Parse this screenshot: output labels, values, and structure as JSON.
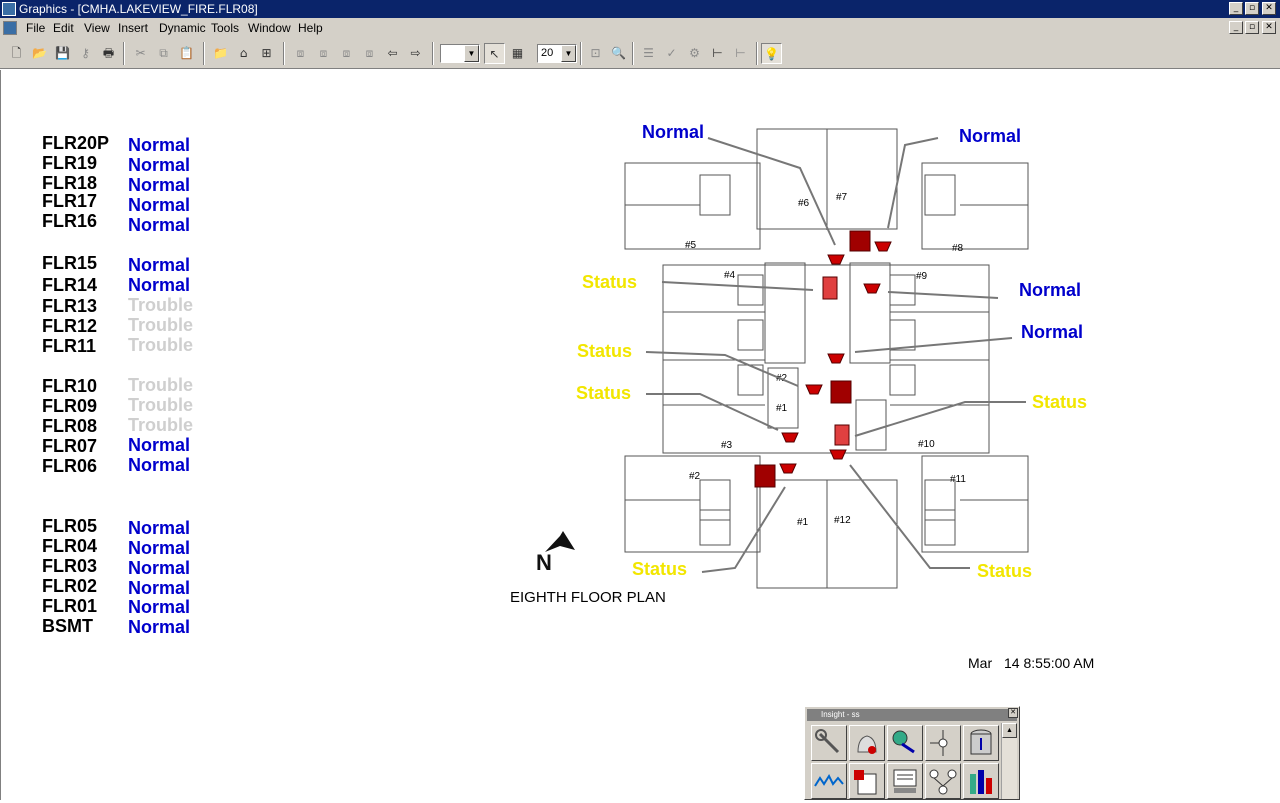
{
  "window": {
    "title": "Graphics - [CMHA.LAKEVIEW_FIRE.FLR08]"
  },
  "menu": [
    "File",
    "Edit",
    "View",
    "Insert",
    "Dynamic",
    "Tools",
    "Window",
    "Help"
  ],
  "toolbar": {
    "zoom_value": "20"
  },
  "floors": [
    {
      "name": "FLR20P",
      "status": "Normal"
    },
    {
      "name": "FLR19",
      "status": "Normal"
    },
    {
      "name": "FLR18",
      "status": "Normal"
    },
    {
      "name": "FLR17",
      "status": "Normal"
    },
    {
      "name": "FLR16",
      "status": "Normal"
    },
    {
      "name": "FLR15",
      "status": "Normal"
    },
    {
      "name": "FLR14",
      "status": "Normal"
    },
    {
      "name": "FLR13",
      "status": "Trouble"
    },
    {
      "name": "FLR12",
      "status": "Trouble"
    },
    {
      "name": "FLR11",
      "status": "Trouble"
    },
    {
      "name": "FLR10",
      "status": "Trouble"
    },
    {
      "name": "FLR09",
      "status": "Trouble"
    },
    {
      "name": "FLR08",
      "status": "Trouble"
    },
    {
      "name": "FLR07",
      "status": "Normal"
    },
    {
      "name": "FLR06",
      "status": "Normal"
    },
    {
      "name": "FLR05",
      "status": "Normal"
    },
    {
      "name": "FLR04",
      "status": "Normal"
    },
    {
      "name": "FLR03",
      "status": "Normal"
    },
    {
      "name": "FLR02",
      "status": "Normal"
    },
    {
      "name": "FLR01",
      "status": "Normal"
    },
    {
      "name": "BSMT",
      "status": "Normal"
    }
  ],
  "plan": {
    "title": "EIGHTH FLOOR PLAN",
    "device_labels": [
      {
        "id": "top-left",
        "text": "Normal"
      },
      {
        "id": "top-right",
        "text": "Normal"
      },
      {
        "id": "right-1",
        "text": "Normal"
      },
      {
        "id": "right-2",
        "text": "Normal"
      },
      {
        "id": "left-1",
        "text": "Status"
      },
      {
        "id": "left-2",
        "text": "Status"
      },
      {
        "id": "left-3",
        "text": "Status"
      },
      {
        "id": "right-3",
        "text": "Status"
      },
      {
        "id": "bottom-left",
        "text": "Status"
      },
      {
        "id": "bottom-right",
        "text": "Status"
      }
    ],
    "room_numbers": [
      "#1",
      "#1",
      "#2",
      "#2",
      "#3",
      "#4",
      "#5",
      "#6",
      "#7",
      "#8",
      "#9",
      "#10",
      "#11",
      "#12"
    ],
    "north_marker": "N"
  },
  "timestamp": {
    "month": "Mar",
    "rest": "14 8:55:00 AM"
  },
  "insight": {
    "title": "Insight - ss"
  },
  "colors": {
    "normal": "#0000cc",
    "trouble": "#cfcfcf",
    "status": "#f2e600",
    "device_red": "#cc0000",
    "titlebar": "#0a246a"
  }
}
